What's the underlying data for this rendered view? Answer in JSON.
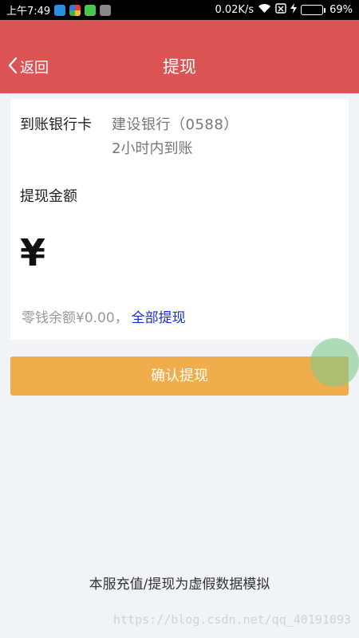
{
  "status_bar": {
    "time": "上午7:49",
    "network_speed": "0.02K/s",
    "battery_percent": "69%",
    "battery_level": 0.69,
    "icons": [
      "app-blue-icon",
      "app-colorful-icon",
      "app-green-icon",
      "app-gray-icon",
      "wifi-icon",
      "sim-off-icon",
      "charging-icon",
      "battery-icon"
    ]
  },
  "nav": {
    "back_label": "返回",
    "title": "提现"
  },
  "card": {
    "bank_label": "到账银行卡",
    "bank_name": "建设银行（0588）",
    "arrival_time": "2小时内到账",
    "amount_label": "提现金额",
    "currency_symbol": "¥",
    "amount_value": "",
    "balance_text": "零钱余额¥0.00，",
    "withdraw_all_label": "全部提现"
  },
  "confirm_button_label": "确认提现",
  "footer_note": "本服充值/提现为虚假数据模拟",
  "watermark": "https://blog.csdn.net/qq_40191093",
  "colors": {
    "nav_background": "#dc5353",
    "confirm_button": "#efad4c",
    "link": "#1a2ecf",
    "page_background": "#f1f4f7"
  }
}
